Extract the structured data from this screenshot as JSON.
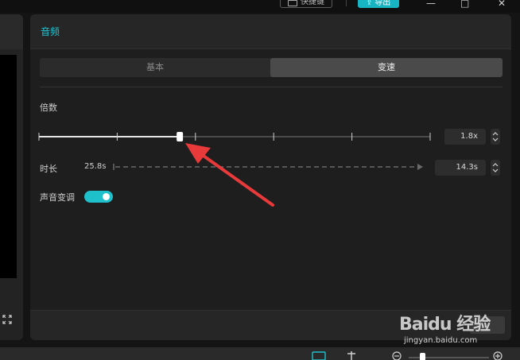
{
  "topbar": {
    "shortcut_label": "快捷键",
    "export_label": "导出",
    "minimize": "—",
    "maximize": "□",
    "close": "✕"
  },
  "panel": {
    "title": "音频",
    "tabs": [
      {
        "label": "基本",
        "active": false
      },
      {
        "label": "变速",
        "active": true
      }
    ],
    "multiplier": {
      "label": "倍数",
      "value": "1.8x",
      "slider_fraction": 0.36
    },
    "duration": {
      "label": "时长",
      "original": "25.8s",
      "value": "14.3s"
    },
    "pitch": {
      "label": "声音变调",
      "enabled": true
    }
  },
  "watermark": {
    "brand": "Baidu 经验",
    "url": "jingyan.baidu.com"
  },
  "colors": {
    "accent": "#21c3cf",
    "arrow": "#e83a3a",
    "export": "#17b5c4"
  }
}
